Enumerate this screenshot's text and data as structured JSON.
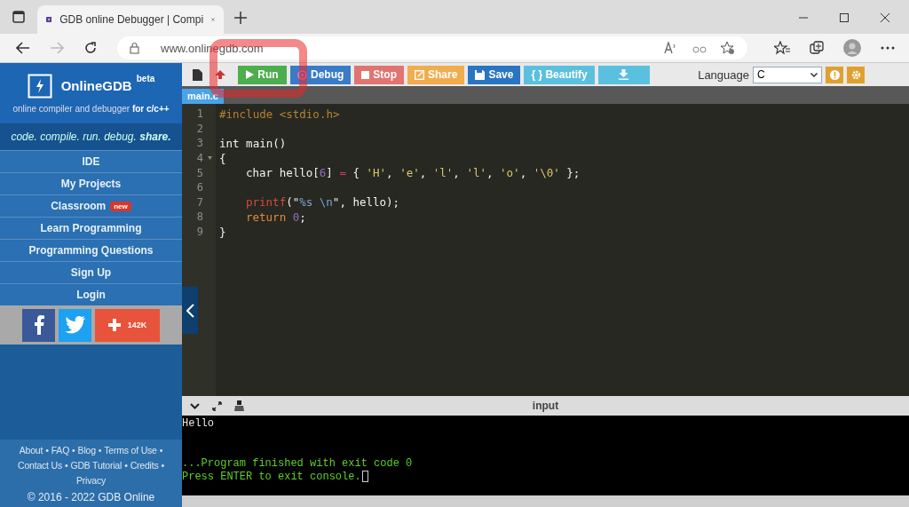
{
  "browser": {
    "tab_title": "GDB online Debugger | Compi",
    "url": "www.onlinegdb.com"
  },
  "sidebar": {
    "brand": "OnlineGDB",
    "brand_badge": "beta",
    "subtitle": "online compiler and debugger **for c/c++**",
    "tagline": "code. compile. run. debug. **share.**",
    "menu": [
      {
        "label": "IDE"
      },
      {
        "label": "My Projects"
      },
      {
        "label": "Classroom",
        "badge": "new"
      },
      {
        "label": "Learn Programming"
      },
      {
        "label": "Programming Questions"
      },
      {
        "label": "Sign Up"
      },
      {
        "label": "Login"
      }
    ],
    "share_count": "142K",
    "footer_links": [
      {
        "label": "About",
        "separator": "•"
      },
      {
        "label": "FAQ",
        "separator": "•"
      },
      {
        "label": "Blog",
        "separator": "•"
      },
      {
        "label": "Terms of Use",
        "separator": "•"
      },
      {
        "label": "Contact Us",
        "separator": "•"
      },
      {
        "label": "GDB Tutorial",
        "separator": "•"
      },
      {
        "label": "Credits",
        "separator": "•"
      },
      {
        "label": "Privacy"
      }
    ],
    "copyright": "© 2016 - 2022 GDB Online"
  },
  "toolbar": {
    "buttons": [
      {
        "kind": "run",
        "label": "Run"
      },
      {
        "kind": "debug",
        "label": "Debug"
      },
      {
        "kind": "stop",
        "label": "Stop"
      },
      {
        "kind": "share",
        "label": "Share"
      },
      {
        "kind": "save",
        "label": "Save"
      },
      {
        "kind": "beautify",
        "label": "{ } Beautify"
      },
      {
        "kind": "download"
      }
    ],
    "language_label": "Language",
    "language_value": "C"
  },
  "file_tab": "main.c",
  "code_lines": [
    {
      "number": "1",
      "tokens": [
        {
          "kind": "preproc",
          "text": "#include <stdio.h>"
        }
      ]
    },
    {
      "number": "2"
    },
    {
      "number": "3",
      "tokens": [
        {
          "kind": "plain",
          "text": "int main()"
        }
      ]
    },
    {
      "number": "4",
      "fold": true,
      "tokens": [
        {
          "kind": "plain",
          "text": "{"
        }
      ]
    },
    {
      "number": "5",
      "indented": true,
      "tokens": [
        {
          "kind": "plain",
          "text": "char hello["
        },
        {
          "kind": "number",
          "text": "6"
        },
        {
          "kind": "plain",
          "text": "] "
        },
        {
          "kind": "operator",
          "text": "="
        },
        {
          "kind": "plain",
          "text": " { "
        },
        {
          "kind": "string",
          "text": "'H'"
        },
        {
          "kind": "plain",
          "text": ", "
        },
        {
          "kind": "string",
          "text": "'e'"
        },
        {
          "kind": "plain",
          "text": ", "
        },
        {
          "kind": "string",
          "text": "'l'"
        },
        {
          "kind": "plain",
          "text": ", "
        },
        {
          "kind": "string",
          "text": "'l'"
        },
        {
          "kind": "plain",
          "text": ", "
        },
        {
          "kind": "string",
          "text": "'o'"
        },
        {
          "kind": "plain",
          "text": ", "
        },
        {
          "kind": "string",
          "text": "'\\0'"
        },
        {
          "kind": "plain",
          "text": " };"
        }
      ]
    },
    {
      "number": "6"
    },
    {
      "number": "7",
      "indented": true,
      "tokens": [
        {
          "kind": "function",
          "text": "printf"
        },
        {
          "kind": "plain",
          "text": "(\""
        },
        {
          "kind": "escape",
          "text": "%s \\n"
        },
        {
          "kind": "plain",
          "text": "\", hello);"
        }
      ]
    },
    {
      "number": "8",
      "indented": true,
      "tokens": [
        {
          "kind": "keyword",
          "text": "return "
        },
        {
          "kind": "number",
          "text": "0"
        },
        {
          "kind": "plain",
          "text": ";"
        }
      ]
    },
    {
      "number": "9",
      "tokens": [
        {
          "kind": "plain",
          "text": "}"
        }
      ]
    }
  ],
  "console": {
    "input_label": "input",
    "lines": [
      {
        "kind": "output",
        "text": "Hello"
      },
      {
        "kind": "status",
        "text": "...Program finished with exit code 0"
      },
      {
        "kind": "status",
        "text": "Press ENTER to exit console.",
        "cursor": true
      }
    ]
  }
}
